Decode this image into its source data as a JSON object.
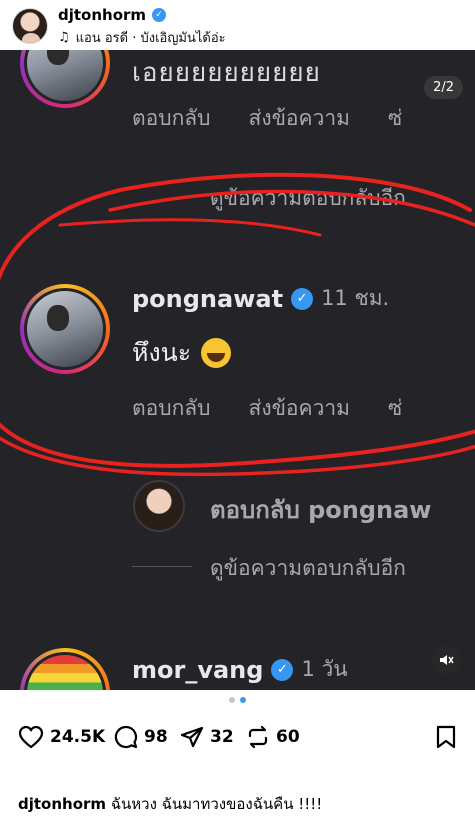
{
  "header": {
    "username": "djtonhorm",
    "music": "แอน อรดี · บังเอิญมันได้อ่ะ"
  },
  "post": {
    "slide_counter": "2/2",
    "top_text": "เอยยยยยยยยยย",
    "actions1": [
      "ตอบกลับ",
      "ส่งข้อความ",
      "ซ่"
    ],
    "view_replies_top": "ดูข้อความตอบกลับอีก",
    "comment_user": "pongnawat",
    "comment_time": "11 ชม.",
    "comment_text": "หึงนะ",
    "actions2": [
      "ตอบกลับ",
      "ส่งข้อความ",
      "ซ่"
    ],
    "reply_to": "ตอบกลับ pongnaw",
    "view_replies_bottom": "ดูข้อความตอบกลับอีก",
    "next_user": "mor_vang",
    "next_time": "1 วัน"
  },
  "stats": {
    "likes": "24.5K",
    "comments": "98",
    "shares": "32",
    "reposts": "60"
  },
  "caption": {
    "username": "djtonhorm",
    "text": "ฉันหวง ฉันมาทวงของฉันคืน !!!!"
  },
  "colors": {
    "verified": "#3897f0",
    "annotation": "#e8231f",
    "dark_bg": "#232328"
  }
}
